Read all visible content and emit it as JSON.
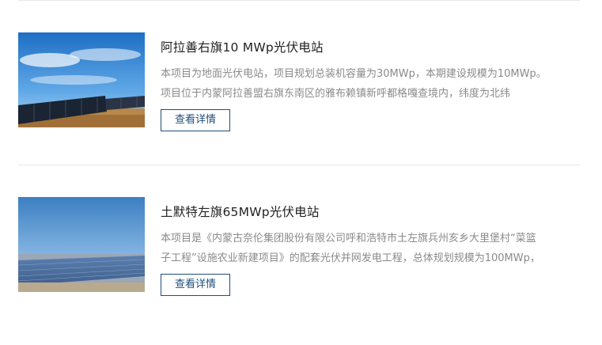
{
  "projects": [
    {
      "title": "阿拉善右旗10 MWp光伏电站",
      "desc_line1": "本项目为地面光伏电站，项目规划总装机容量为30MWp，本期建设规模为10MWp。",
      "desc_line2": "项目位于内蒙阿拉善盟右旗东南区的雅布赖镇新呼都格嘎查境内，纬度为北纬",
      "button_label": "查看详情",
      "image": "solar-panels-desert-photo"
    },
    {
      "title": "土默特左旗65MWp光伏电站",
      "desc_line1": "本项目是《内蒙古奈伦集团股份有限公司呼和浩特市土左旗兵州亥乡大里堡村“菜篮",
      "desc_line2": "子工程”设施农业新建项目》的配套光伏并网发电工程，总体规划规模为100MWp，",
      "button_label": "查看详情",
      "image": "solar-farm-field-photo"
    }
  ],
  "colors": {
    "button_border": "#1f4e79",
    "title_text": "#222222",
    "desc_text": "#8a8a8a",
    "divider": "#e6e6e6"
  }
}
